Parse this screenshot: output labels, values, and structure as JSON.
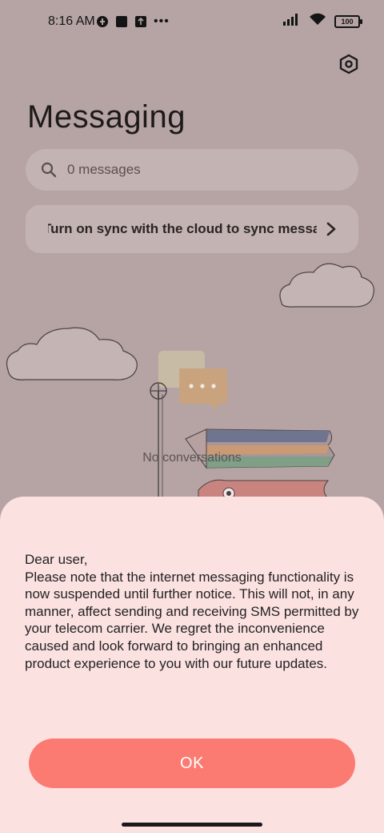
{
  "status_bar": {
    "time": "8:16 AM",
    "battery": "100"
  },
  "header": {
    "title": "Messaging"
  },
  "search": {
    "text": "0 messages"
  },
  "sync_banner": {
    "text": "Turn on sync with the cloud to sync messages"
  },
  "empty_state": {
    "text": "No conversations"
  },
  "dialog": {
    "greeting": "Dear user,",
    "message": "Please note that the internet messaging functionality is now suspended until further notice. This will not, in any manner, affect sending and receiving SMS permitted by your telecom carrier. We regret the inconvenience caused and look forward to bringing an enhanced product experience to you with our future updates.",
    "ok_label": "OK"
  },
  "colors": {
    "dimmed_background": "#b6a4a4",
    "sheet_background": "#fce1e1",
    "accent": "#fb7b72"
  }
}
